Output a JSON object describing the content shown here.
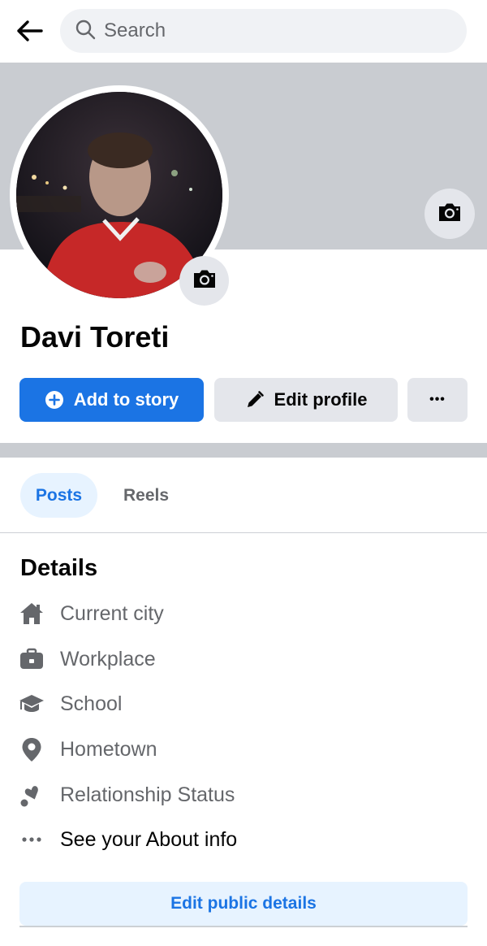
{
  "search": {
    "placeholder": "Search"
  },
  "profile": {
    "name": "Davi Toreti"
  },
  "actions": {
    "add_story": "Add to story",
    "edit_profile": "Edit profile",
    "more": "•••"
  },
  "tabs": [
    {
      "label": "Posts",
      "active": true
    },
    {
      "label": "Reels",
      "active": false
    }
  ],
  "details": {
    "title": "Details",
    "items": [
      {
        "label": "Current city",
        "icon": "home-icon"
      },
      {
        "label": "Workplace",
        "icon": "briefcase-icon"
      },
      {
        "label": "School",
        "icon": "graduation-cap-icon"
      },
      {
        "label": "Hometown",
        "icon": "location-pin-icon"
      },
      {
        "label": "Relationship Status",
        "icon": "hearts-icon"
      },
      {
        "label": "See your About info",
        "icon": "more-dots-icon"
      }
    ],
    "edit_button": "Edit public details"
  },
  "colors": {
    "accent": "#1b74e4",
    "accent_light": "#e7f3ff",
    "secondary_button": "#e4e6eb",
    "cover": "#c9ccd1",
    "muted_text": "#65676b"
  }
}
